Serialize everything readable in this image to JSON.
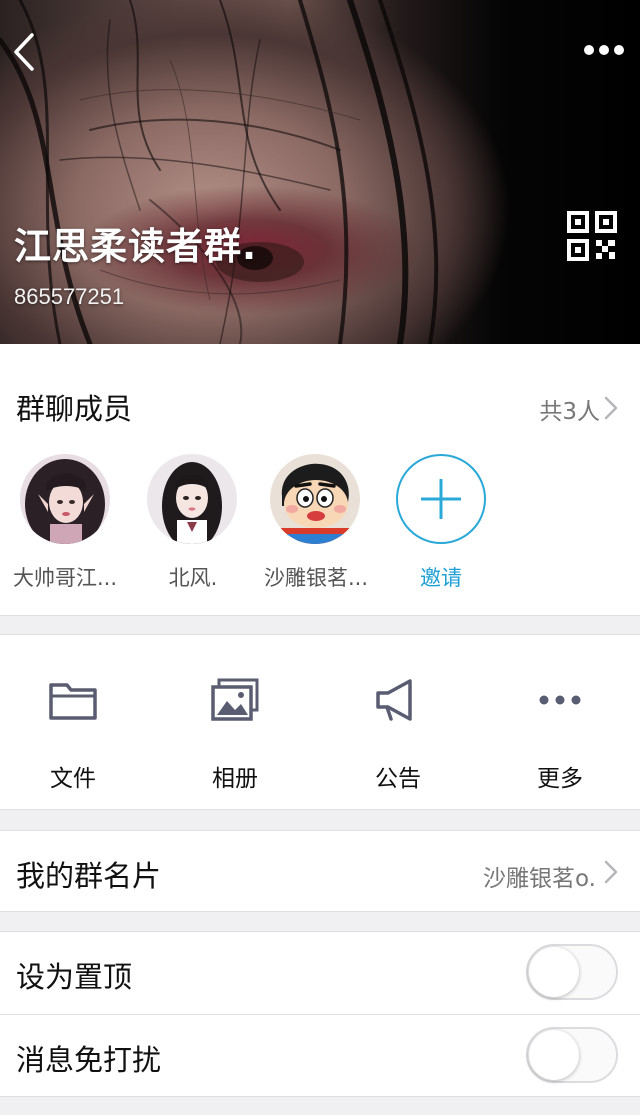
{
  "header": {
    "title": "江思柔读者群.",
    "group_id": "865577251",
    "back_icon": "chevron-left-icon",
    "more_icon": "more-horizontal-icon",
    "qr_icon": "qr-code-icon"
  },
  "members": {
    "title": "群聊成员",
    "count": "共3人",
    "list": [
      {
        "name": "大帅哥江...",
        "avatar": "avatar-girl-elf-ears"
      },
      {
        "name": "北风.",
        "avatar": "avatar-girl-long-hair"
      },
      {
        "name": "沙雕银茗...",
        "avatar": "avatar-cartoon-boy"
      }
    ],
    "invite_label": "邀请"
  },
  "shortcuts": [
    {
      "label": "文件",
      "icon": "folder-icon"
    },
    {
      "label": "相册",
      "icon": "photo-album-icon"
    },
    {
      "label": "公告",
      "icon": "megaphone-icon"
    },
    {
      "label": "更多",
      "icon": "more-dots-icon"
    }
  ],
  "card_name": {
    "label": "我的群名片",
    "value": "沙雕银茗o."
  },
  "settings": [
    {
      "label": "设为置顶",
      "enabled": false
    },
    {
      "label": "消息免打扰",
      "enabled": false
    }
  ],
  "colors": {
    "accent": "#1e9fd6",
    "icon_gray": "#5a5d72",
    "background": "#f0f0f2"
  }
}
